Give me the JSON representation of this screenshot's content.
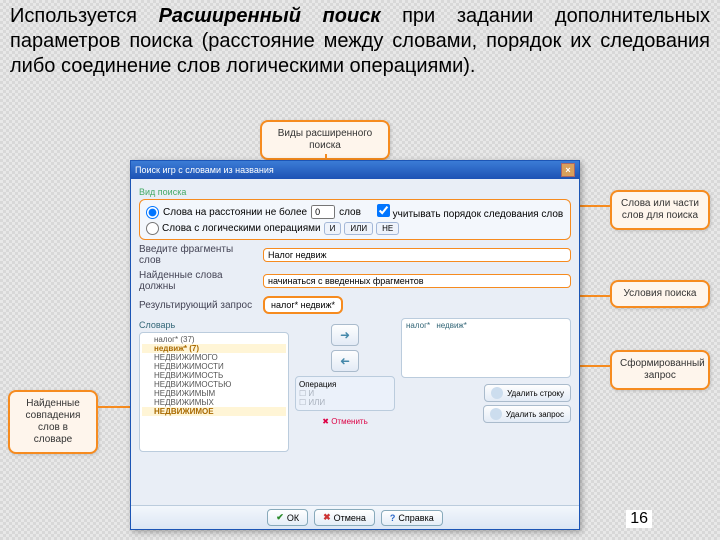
{
  "description": {
    "p1a": "Используется",
    "p1b": "Расширенный поиск",
    "p1c": "при задании дополнительных параметров поиска (расстояние между словами, порядок их следования либо соединение слов логическими операциями)."
  },
  "callouts": {
    "top": "Виды расширенного поиска",
    "left": "Найденные совпадения слов в словаре",
    "r1": "Слова или части слов для поиска",
    "r2": "Условия поиска",
    "r3": "Сформированный запрос"
  },
  "dialog": {
    "title": "Поиск игр с словами из названия",
    "close": "×",
    "vid": "Вид поиска",
    "radio1": "Слова на расстоянии не более",
    "dist_val": "0",
    "dist_unit": "слов",
    "chk_label": "учитывать порядок следования слов",
    "radio2": "Слова с логическими операциями",
    "ops": {
      "and": "И",
      "or": "ИЛИ",
      "not": "НЕ"
    },
    "frag_label": "Введите фрагменты слов",
    "frag_value": "Налог недвиж",
    "found_label": "Найденные слова должны",
    "found_value": "начинаться с введенных фрагментов",
    "result_label": "Результирующий запрос",
    "result_value": "налог* недвиж*",
    "dict_hdr": "Словарь",
    "dict_items": [
      "налог* (37)",
      "недвиж* (7)",
      "НЕДВИЖИМОГО",
      "НЕДВИЖИМОСТИ",
      "НЕДВИЖИМОСТЬ",
      "НЕДВИЖИМОСТЬЮ",
      "НЕДВИЖИМЫМ",
      "НЕДВИЖИМЫХ",
      "НЕДВИЖИМОЕ"
    ],
    "operation_hdr": "Операция",
    "op_and": "И",
    "op_or": "ИЛИ",
    "cancel": "Отменить",
    "tags": [
      "налог*",
      "недвиж*"
    ],
    "del_row": "Удалить строку",
    "del_query": "Удалить запрос",
    "ok": "ОК",
    "cancel_btn": "Отмена",
    "help": "Справка"
  },
  "pagenum": "16"
}
